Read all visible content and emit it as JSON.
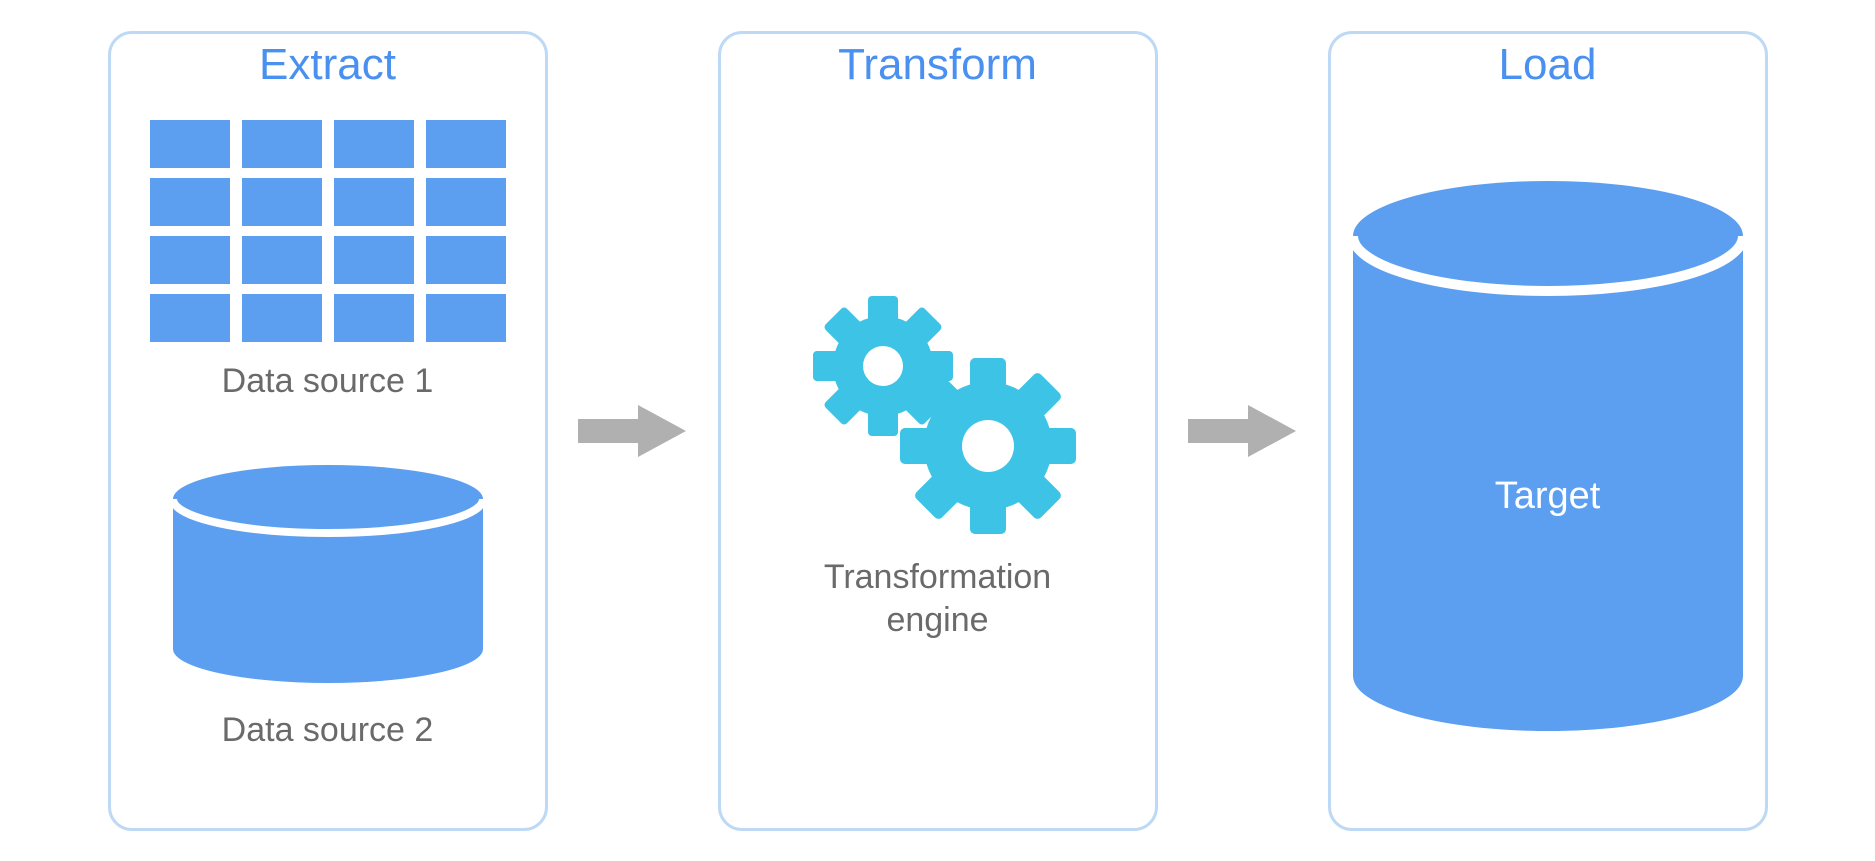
{
  "stages": {
    "extract": {
      "title": "Extract",
      "source1_label": "Data source 1",
      "source2_label": "Data source 2"
    },
    "transform": {
      "title": "Transform",
      "engine_label_line1": "Transformation",
      "engine_label_line2": "engine"
    },
    "load": {
      "title": "Load",
      "target_label": "Target"
    }
  },
  "colors": {
    "border": "#bdd9f5",
    "title": "#4a90f0",
    "cell": "#5c9ff1",
    "cylinder": "#5c9ff1",
    "gears": "#3cc3e6",
    "arrow": "#b0b0b0",
    "caption": "#6a6a6a",
    "white": "#ffffff"
  }
}
